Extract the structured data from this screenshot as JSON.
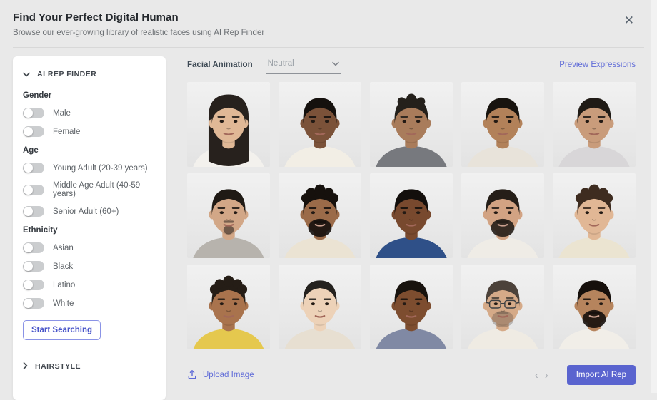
{
  "header": {
    "title": "Find Your Perfect Digital Human",
    "subtitle": "Browse our ever-growing library of realistic faces using AI Rep Finder",
    "close_icon": "✕"
  },
  "sidebar": {
    "finder_title": "AI REP FINDER",
    "hairstyle_title": "HAIRSTYLE",
    "start_button_label": "Start Searching",
    "groups": [
      {
        "label": "Gender",
        "options": [
          {
            "label": "Male",
            "on": false
          },
          {
            "label": "Female",
            "on": false
          }
        ]
      },
      {
        "label": "Age",
        "options": [
          {
            "label": "Young Adult (20-39 years)",
            "on": false
          },
          {
            "label": "Middle Age Adult (40-59 years)",
            "on": false
          },
          {
            "label": "Senior Adult (60+)",
            "on": false
          }
        ]
      },
      {
        "label": "Ethnicity",
        "options": [
          {
            "label": "Asian",
            "on": false
          },
          {
            "label": "Black",
            "on": false
          },
          {
            "label": "Latino",
            "on": false
          },
          {
            "label": "White",
            "on": false
          }
        ]
      }
    ]
  },
  "main": {
    "facial_animation_label": "Facial Animation",
    "facial_animation_value": "Neutral",
    "preview_link": "Preview Expressions",
    "upload_label": "Upload Image",
    "import_button_label": "Import AI Rep",
    "pager_prev": "‹",
    "pager_next": "›",
    "faces": [
      {
        "description": "young woman, long dark hair, white top",
        "gender": "female",
        "skin": "#e0b896",
        "hair": "#27211d",
        "hair_style": "long",
        "shirt": "#f3f1ed",
        "beard": "none",
        "glasses": false
      },
      {
        "description": "young man, short black hair, white shirt",
        "gender": "male",
        "skin": "#7b5239",
        "hair": "#15110e",
        "hair_style": "short",
        "shirt": "#f2eee5",
        "beard": "none",
        "glasses": false
      },
      {
        "description": "man, dark wavy hair, gray shirt",
        "gender": "male",
        "skin": "#a97c5b",
        "hair": "#24201b",
        "hair_style": "wavy",
        "shirt": "#77797e",
        "beard": "none",
        "glasses": false
      },
      {
        "description": "young man, black hair, light tee",
        "gender": "male",
        "skin": "#b28159",
        "hair": "#18140f",
        "hair_style": "short",
        "shirt": "#e8e3da",
        "beard": "none",
        "glasses": false
      },
      {
        "description": "man, dark hair, white shirt and gray jacket",
        "gender": "male",
        "skin": "#c99c7b",
        "hair": "#201b16",
        "hair_style": "short",
        "shirt": "#d8d6d8",
        "beard": "none",
        "glasses": false
      },
      {
        "description": "man, short dark hair, goatee, gray shirt",
        "gender": "male",
        "skin": "#d2a787",
        "hair": "#1f1a15",
        "hair_style": "short",
        "shirt": "#b7b3ad",
        "beard": "goatee",
        "glasses": false
      },
      {
        "description": "man, black curly hair, full beard, cream shirt",
        "gender": "male",
        "skin": "#9b6b49",
        "hair": "#16110d",
        "hair_style": "curly",
        "shirt": "#ebe3d3",
        "beard": "full",
        "glasses": false
      },
      {
        "description": "young man, dark skin, blue shirt",
        "gender": "male",
        "skin": "#78492e",
        "hair": "#130f0c",
        "hair_style": "short",
        "shirt": "#2f5088",
        "beard": "none",
        "glasses": false
      },
      {
        "description": "man, dark hair, full beard, white shirt",
        "gender": "male",
        "skin": "#d2a383",
        "hair": "#251e18",
        "hair_style": "short",
        "shirt": "#efece6",
        "beard": "full",
        "glasses": false
      },
      {
        "description": "woman, short curly brown hair, cream top",
        "gender": "female",
        "skin": "#e1b795",
        "hair": "#3e2c20",
        "hair_style": "curly",
        "shirt": "#ebe4d1",
        "beard": "none",
        "glasses": false
      },
      {
        "description": "person, dark curly hair, yellow top",
        "gender": "male",
        "skin": "#a9734d",
        "hair": "#251d16",
        "hair_style": "curly",
        "shirt": "#e5c84e",
        "beard": "none",
        "glasses": false
      },
      {
        "description": "woman, dark hair pulled back, pale top",
        "gender": "female",
        "skin": "#edd2b8",
        "hair": "#24211e",
        "hair_style": "slick",
        "shirt": "#e7dfd1",
        "beard": "none",
        "glasses": false
      },
      {
        "description": "man, dark skin, blue-gray shirt",
        "gender": "male",
        "skin": "#7d4d2f",
        "hair": "#18130e",
        "hair_style": "short",
        "shirt": "#8089a4",
        "beard": "none",
        "glasses": false
      },
      {
        "description": "man with glasses, graying stubble beard, white shirt",
        "gender": "male",
        "skin": "#d5aa88",
        "hair": "#4c423a",
        "hair_style": "short",
        "shirt": "#efebe3",
        "beard": "stubble",
        "glasses": true
      },
      {
        "description": "man, black hair and mustache, full beard, white shirt",
        "gender": "male",
        "skin": "#b6845d",
        "hair": "#16100c",
        "hair_style": "short",
        "shirt": "#f1eee8",
        "beard": "full",
        "glasses": false
      }
    ]
  },
  "colors": {
    "accent": "#5a64cf",
    "link": "#5f6bd8",
    "page_background": "#e9e9e9",
    "panel_background": "#ffffff",
    "toggle_track": "#cbcdcf"
  }
}
